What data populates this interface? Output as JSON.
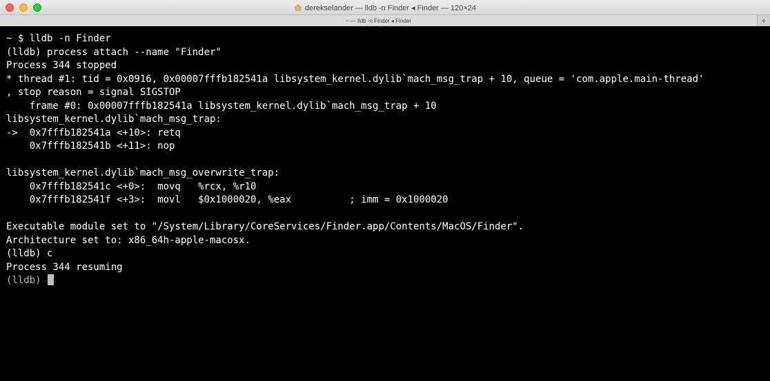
{
  "window": {
    "title": "derekselander — lldb -n Finder ◂ Finder — 120×24",
    "tab_label": "~ — lldb -n Finder ◂ Finder",
    "add_tab_label": "+"
  },
  "icons": {
    "close": "close-icon",
    "minimize": "minimize-icon",
    "zoom": "zoom-icon",
    "title": "home-folder-icon",
    "cursor": "terminal-cursor"
  },
  "colors": {
    "close": "#fc5f57",
    "minimize": "#fdbc2e",
    "zoom": "#28c840",
    "terminal_bg": "#000000",
    "terminal_fg": "#ffffff",
    "cursor": "#bdbdbd"
  },
  "terminal": {
    "lines": [
      {
        "text": "~ $ lldb -n Finder",
        "dim": false
      },
      {
        "text": "(lldb) process attach --name \"Finder\"",
        "dim": false
      },
      {
        "text": "Process 344 stopped",
        "dim": false
      },
      {
        "text": "* thread #1: tid = 0x0916, 0x00007fffb182541a libsystem_kernel.dylib`mach_msg_trap + 10, queue = 'com.apple.main-thread'",
        "dim": false
      },
      {
        "text": ", stop reason = signal SIGSTOP",
        "dim": false
      },
      {
        "text": "    frame #0: 0x00007fffb182541a libsystem_kernel.dylib`mach_msg_trap + 10",
        "dim": false
      },
      {
        "text": "libsystem_kernel.dylib`mach_msg_trap:",
        "dim": false
      },
      {
        "text": "->  0x7fffb182541a <+10>: retq",
        "dim": false
      },
      {
        "text": "    0x7fffb182541b <+11>: nop",
        "dim": false
      },
      {
        "text": "",
        "dim": false
      },
      {
        "text": "libsystem_kernel.dylib`mach_msg_overwrite_trap:",
        "dim": false
      },
      {
        "text": "    0x7fffb182541c <+0>:  movq   %rcx, %r10",
        "dim": false
      },
      {
        "text": "    0x7fffb182541f <+3>:  movl   $0x1000020, %eax          ; imm = 0x1000020",
        "dim": false
      },
      {
        "text": "",
        "dim": false
      },
      {
        "text": "Executable module set to \"/System/Library/CoreServices/Finder.app/Contents/MacOS/Finder\".",
        "dim": false
      },
      {
        "text": "Architecture set to: x86_64h-apple-macosx.",
        "dim": false
      },
      {
        "text": "(lldb) c",
        "dim": false
      },
      {
        "text": "Process 344 resuming",
        "dim": false
      }
    ],
    "prompt": "(lldb) "
  }
}
